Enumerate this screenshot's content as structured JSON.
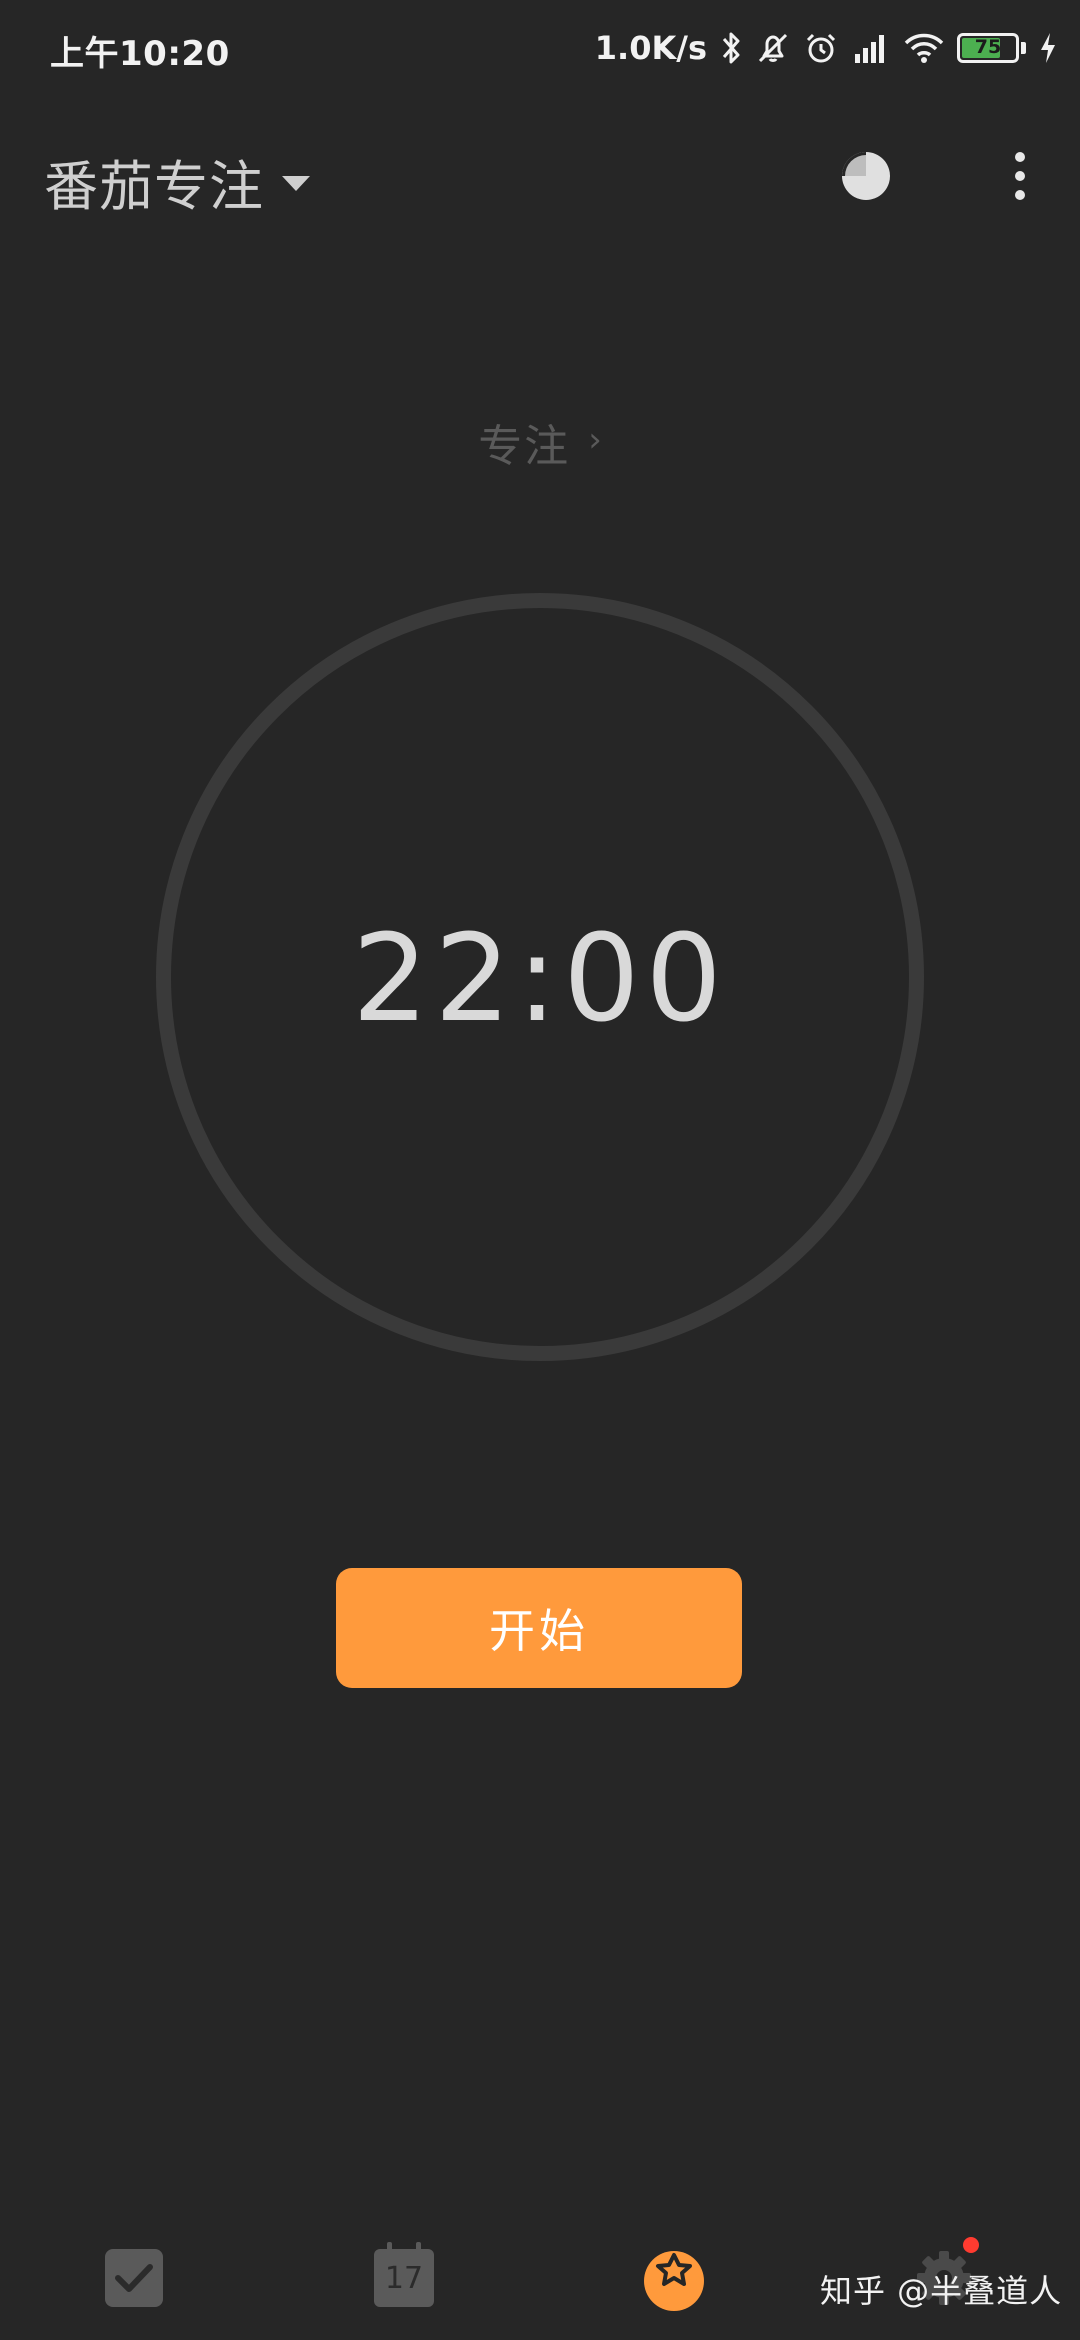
{
  "status_bar": {
    "time": "上午10:20",
    "net_speed": "1.0K/s",
    "battery_level": "75",
    "battery_fraction": 0.75,
    "battery_color": "#4caf50",
    "icons": [
      "bluetooth-icon",
      "mute-icon",
      "alarm-icon",
      "signal-icon",
      "wifi-icon",
      "battery-icon",
      "charging-icon"
    ]
  },
  "app_bar": {
    "title": "番茄专注",
    "icons": [
      "caret-down-icon",
      "pie-chart-icon",
      "more-vertical-icon"
    ]
  },
  "timer": {
    "mode_label": "专注",
    "mode_chevron": "›",
    "time": "22:00"
  },
  "actions": {
    "start_label": "开始",
    "accent_color": "#ff9a3c"
  },
  "bottom_nav": {
    "items": [
      {
        "icon": "checkbox-icon"
      },
      {
        "icon": "calendar-icon",
        "day": "17"
      },
      {
        "icon": "pomodoro-icon",
        "active": true
      },
      {
        "icon": "settings-icon",
        "badge": true
      }
    ]
  },
  "watermark": {
    "text": "知乎 @半叠道人"
  }
}
